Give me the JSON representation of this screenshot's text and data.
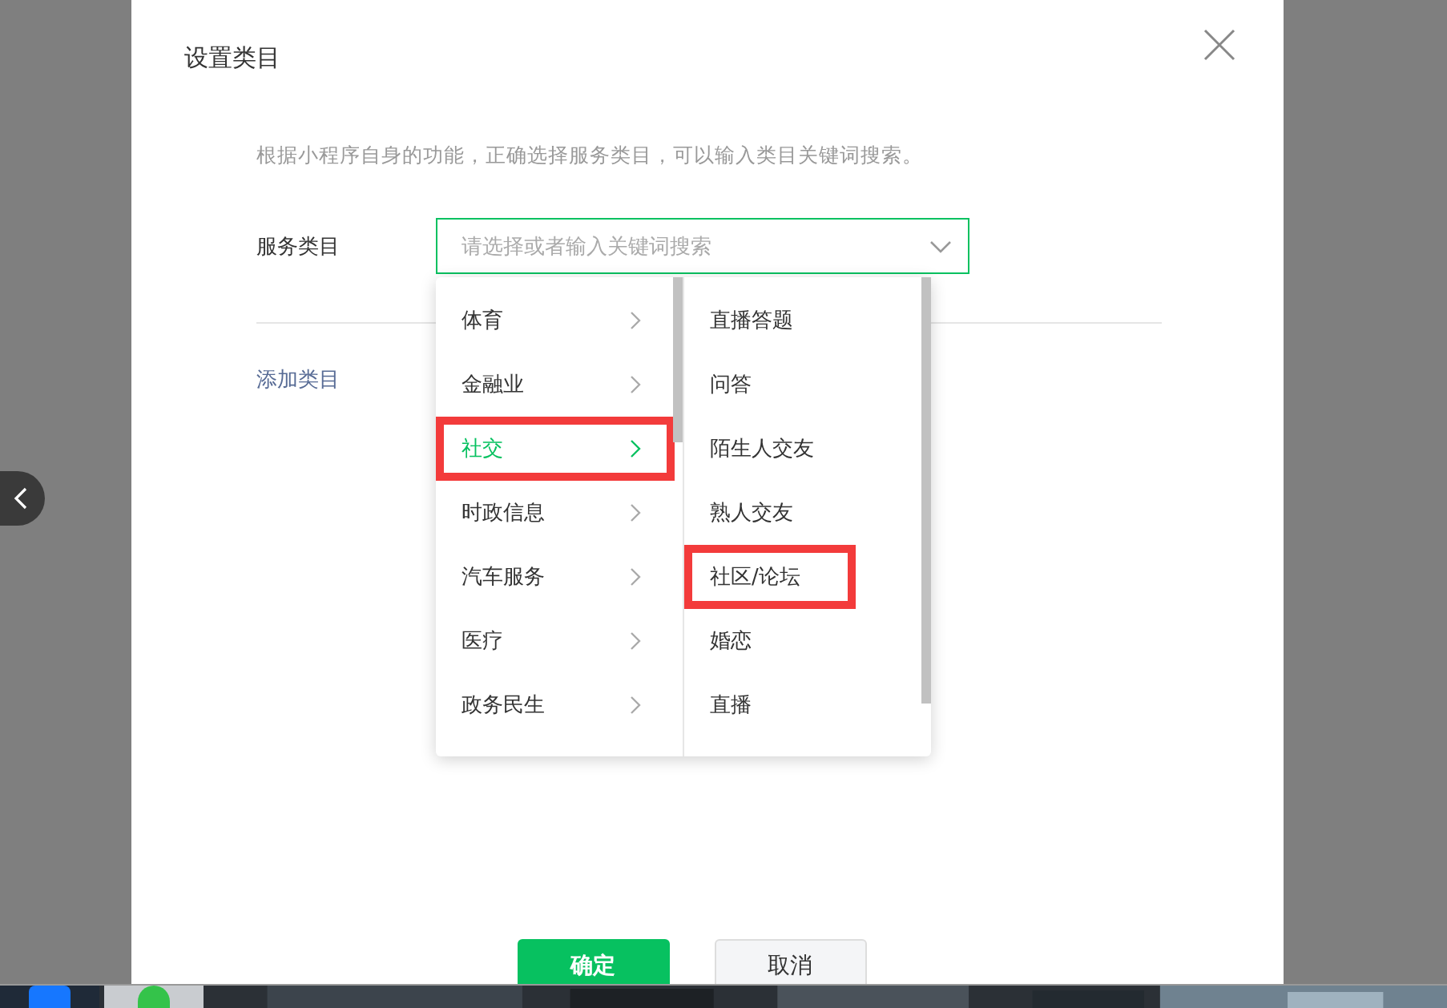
{
  "dialog": {
    "title": "设置类目",
    "description": "根据小程序自身的功能，正确选择服务类目，可以输入类目关键词搜索。",
    "field_label": "服务类目",
    "select": {
      "placeholder": "请选择或者输入关键词搜索",
      "expanded": true
    },
    "categories": [
      {
        "label": "体育",
        "selected": false,
        "highlighted": false
      },
      {
        "label": "金融业",
        "selected": false,
        "highlighted": false
      },
      {
        "label": "社交",
        "selected": true,
        "highlighted": true
      },
      {
        "label": "时政信息",
        "selected": false,
        "highlighted": false
      },
      {
        "label": "汽车服务",
        "selected": false,
        "highlighted": false
      },
      {
        "label": "医疗",
        "selected": false,
        "highlighted": false
      },
      {
        "label": "政务民生",
        "selected": false,
        "highlighted": false
      }
    ],
    "subcategories": [
      {
        "label": "直播答题",
        "highlighted": false
      },
      {
        "label": "问答",
        "highlighted": false
      },
      {
        "label": "陌生人交友",
        "highlighted": false
      },
      {
        "label": "熟人交友",
        "highlighted": false
      },
      {
        "label": "社区/论坛",
        "highlighted": true
      },
      {
        "label": "婚恋",
        "highlighted": false
      },
      {
        "label": "直播",
        "highlighted": false
      }
    ],
    "add_link": "添加类目",
    "buttons": [
      {
        "label": "确定",
        "kind": "primary"
      },
      {
        "label": "取消",
        "kind": "secondary"
      }
    ]
  }
}
